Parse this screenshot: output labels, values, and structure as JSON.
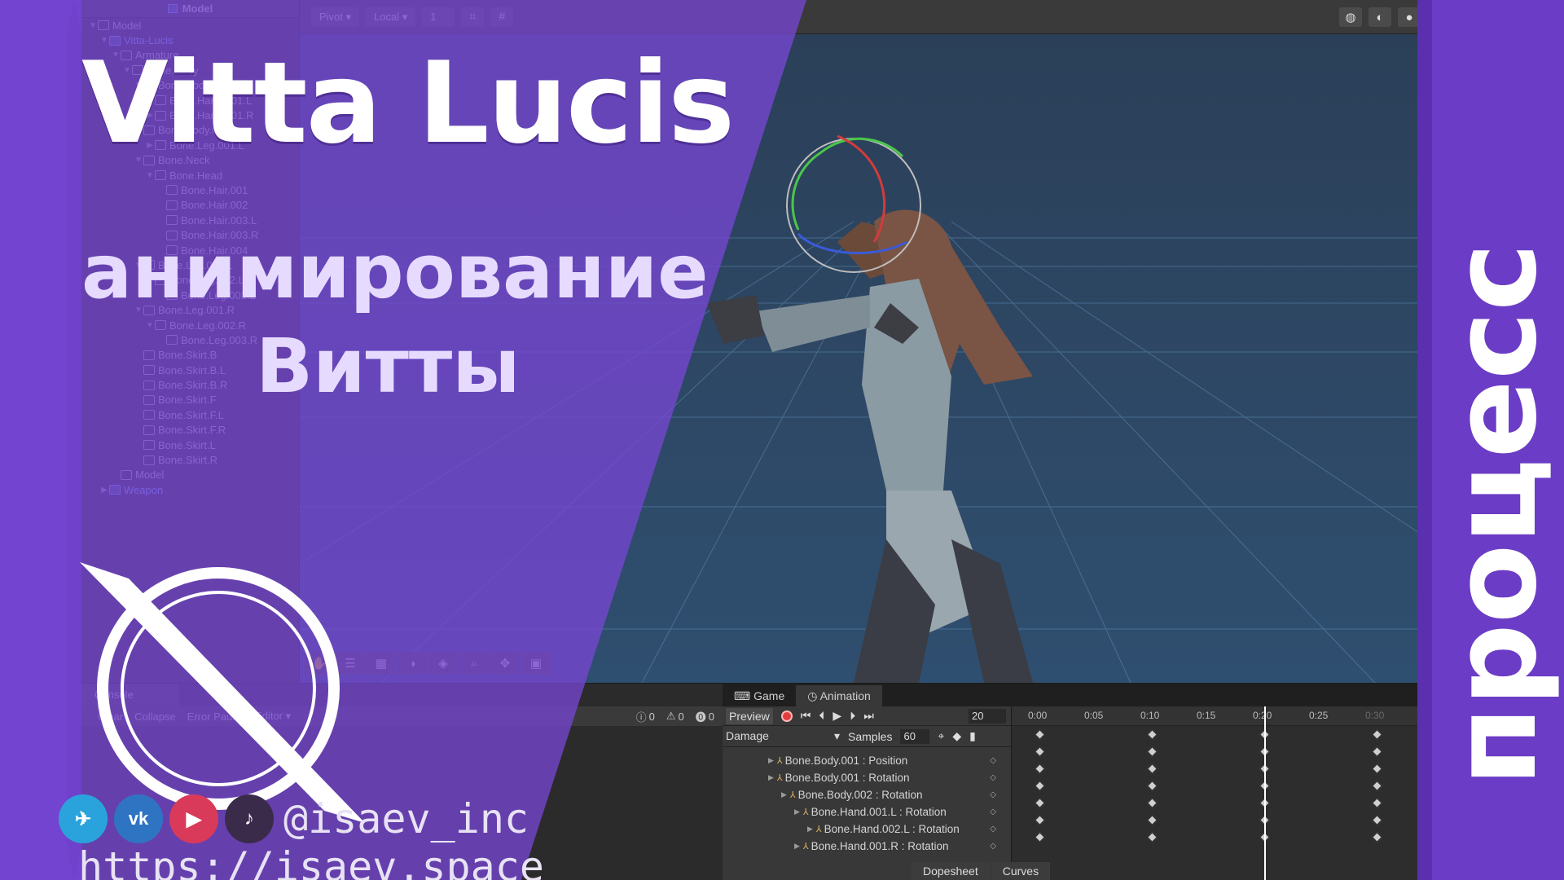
{
  "overlay": {
    "title": "Vitta Lucis",
    "subtitle_line1": "анимирование",
    "subtitle_line2": "Витты",
    "vertical_label": "процесс",
    "social_handle": "@isaev_inc",
    "url": "https://isaev.space",
    "social_icons": [
      "telegram-icon",
      "vk-icon",
      "youtube-icon",
      "tiktok-icon"
    ],
    "vk_glyph": "vk",
    "youtube_glyph": "▶",
    "tiktok_glyph": "♪",
    "telegram_glyph": "✈"
  },
  "hierarchy": {
    "header": "Model",
    "rows": [
      {
        "label": "Model",
        "depth": 0,
        "arrow": "▼",
        "prefab": false
      },
      {
        "label": "Vitta-Lucis",
        "depth": 1,
        "arrow": "▼",
        "prefab": true
      },
      {
        "label": "Armature",
        "depth": 2,
        "arrow": "▼",
        "prefab": false
      },
      {
        "label": "Bone.Body",
        "depth": 3,
        "arrow": "▼",
        "prefab": false
      },
      {
        "label": "Bone.Body.001",
        "depth": 4,
        "arrow": "▼",
        "prefab": false
      },
      {
        "label": "Bone.Hand.001.L",
        "depth": 5,
        "arrow": "▶",
        "prefab": false
      },
      {
        "label": "Bone.Hand.001.R",
        "depth": 5,
        "arrow": "▶",
        "prefab": false
      },
      {
        "label": "Bone.Body.002",
        "depth": 4,
        "arrow": "▼",
        "prefab": false
      },
      {
        "label": "Bone.Leg.001.L",
        "depth": 5,
        "arrow": "▶",
        "prefab": false
      },
      {
        "label": "Bone.Neck",
        "depth": 4,
        "arrow": "▼",
        "prefab": false
      },
      {
        "label": "Bone.Head",
        "depth": 5,
        "arrow": "▼",
        "prefab": false
      },
      {
        "label": "Bone.Hair.001",
        "depth": 6,
        "arrow": "",
        "prefab": false
      },
      {
        "label": "Bone.Hair.002",
        "depth": 6,
        "arrow": "",
        "prefab": false
      },
      {
        "label": "Bone.Hair.003.L",
        "depth": 6,
        "arrow": "",
        "prefab": false
      },
      {
        "label": "Bone.Hair.003.R",
        "depth": 6,
        "arrow": "",
        "prefab": false
      },
      {
        "label": "Bone.Hair.004",
        "depth": 6,
        "arrow": "",
        "prefab": false
      },
      {
        "label": "Bone.Leg.001.L",
        "depth": 4,
        "arrow": "▼",
        "prefab": false
      },
      {
        "label": "Bone.Leg.002.L",
        "depth": 5,
        "arrow": "▼",
        "prefab": false
      },
      {
        "label": "Bone.Leg.003.L",
        "depth": 6,
        "arrow": "",
        "prefab": false
      },
      {
        "label": "Bone.Leg.001.R",
        "depth": 4,
        "arrow": "▼",
        "prefab": false
      },
      {
        "label": "Bone.Leg.002.R",
        "depth": 5,
        "arrow": "▼",
        "prefab": false
      },
      {
        "label": "Bone.Leg.003.R",
        "depth": 6,
        "arrow": "",
        "prefab": false
      },
      {
        "label": "Bone.Skirt.B",
        "depth": 4,
        "arrow": "",
        "prefab": false
      },
      {
        "label": "Bone.Skirt.B.L",
        "depth": 4,
        "arrow": "",
        "prefab": false
      },
      {
        "label": "Bone.Skirt.B.R",
        "depth": 4,
        "arrow": "",
        "prefab": false
      },
      {
        "label": "Bone.Skirt.F",
        "depth": 4,
        "arrow": "",
        "prefab": false
      },
      {
        "label": "Bone.Skirt.F.L",
        "depth": 4,
        "arrow": "",
        "prefab": false
      },
      {
        "label": "Bone.Skirt.F.R",
        "depth": 4,
        "arrow": "",
        "prefab": false
      },
      {
        "label": "Bone.Skirt.L",
        "depth": 4,
        "arrow": "",
        "prefab": false
      },
      {
        "label": "Bone.Skirt.R",
        "depth": 4,
        "arrow": "",
        "prefab": false
      },
      {
        "label": "Model",
        "depth": 2,
        "arrow": "",
        "prefab": false
      },
      {
        "label": "Weapon",
        "depth": 1,
        "arrow": "▶",
        "prefab": true
      }
    ]
  },
  "scene_toolbar": {
    "pivot": "Pivot",
    "local": "Local",
    "grid_value": "1"
  },
  "console": {
    "tab": "Console",
    "clear": "Clear",
    "collapse": "Collapse",
    "error_pause": "Error Pause",
    "editor": "Editor",
    "count_info": "0",
    "count_warn": "0",
    "count_error": "0"
  },
  "animation": {
    "tab_game": "Game",
    "tab_animation": "Animation",
    "preview": "Preview",
    "frame": "20",
    "clip": "Damage",
    "samples_label": "Samples",
    "samples": "60",
    "ruler": [
      "0:00",
      "0:05",
      "0:10",
      "0:15",
      "0:20",
      "0:25",
      "0:30"
    ],
    "properties": [
      {
        "label": "Bone.Body.001 : Position",
        "depth": 0
      },
      {
        "label": "Bone.Body.001 : Rotation",
        "depth": 0
      },
      {
        "label": "Bone.Body.002 : Rotation",
        "depth": 1
      },
      {
        "label": "Bone.Hand.001.L : Rotation",
        "depth": 2
      },
      {
        "label": "Bone.Hand.002.L : Rotation",
        "depth": 3
      },
      {
        "label": "Bone.Hand.001.R : Rotation",
        "depth": 2
      }
    ],
    "keyframe_times": [
      "0:00",
      "0:10",
      "0:20",
      "0:30"
    ],
    "dopesheet": "Dopesheet",
    "curves": "Curves"
  }
}
